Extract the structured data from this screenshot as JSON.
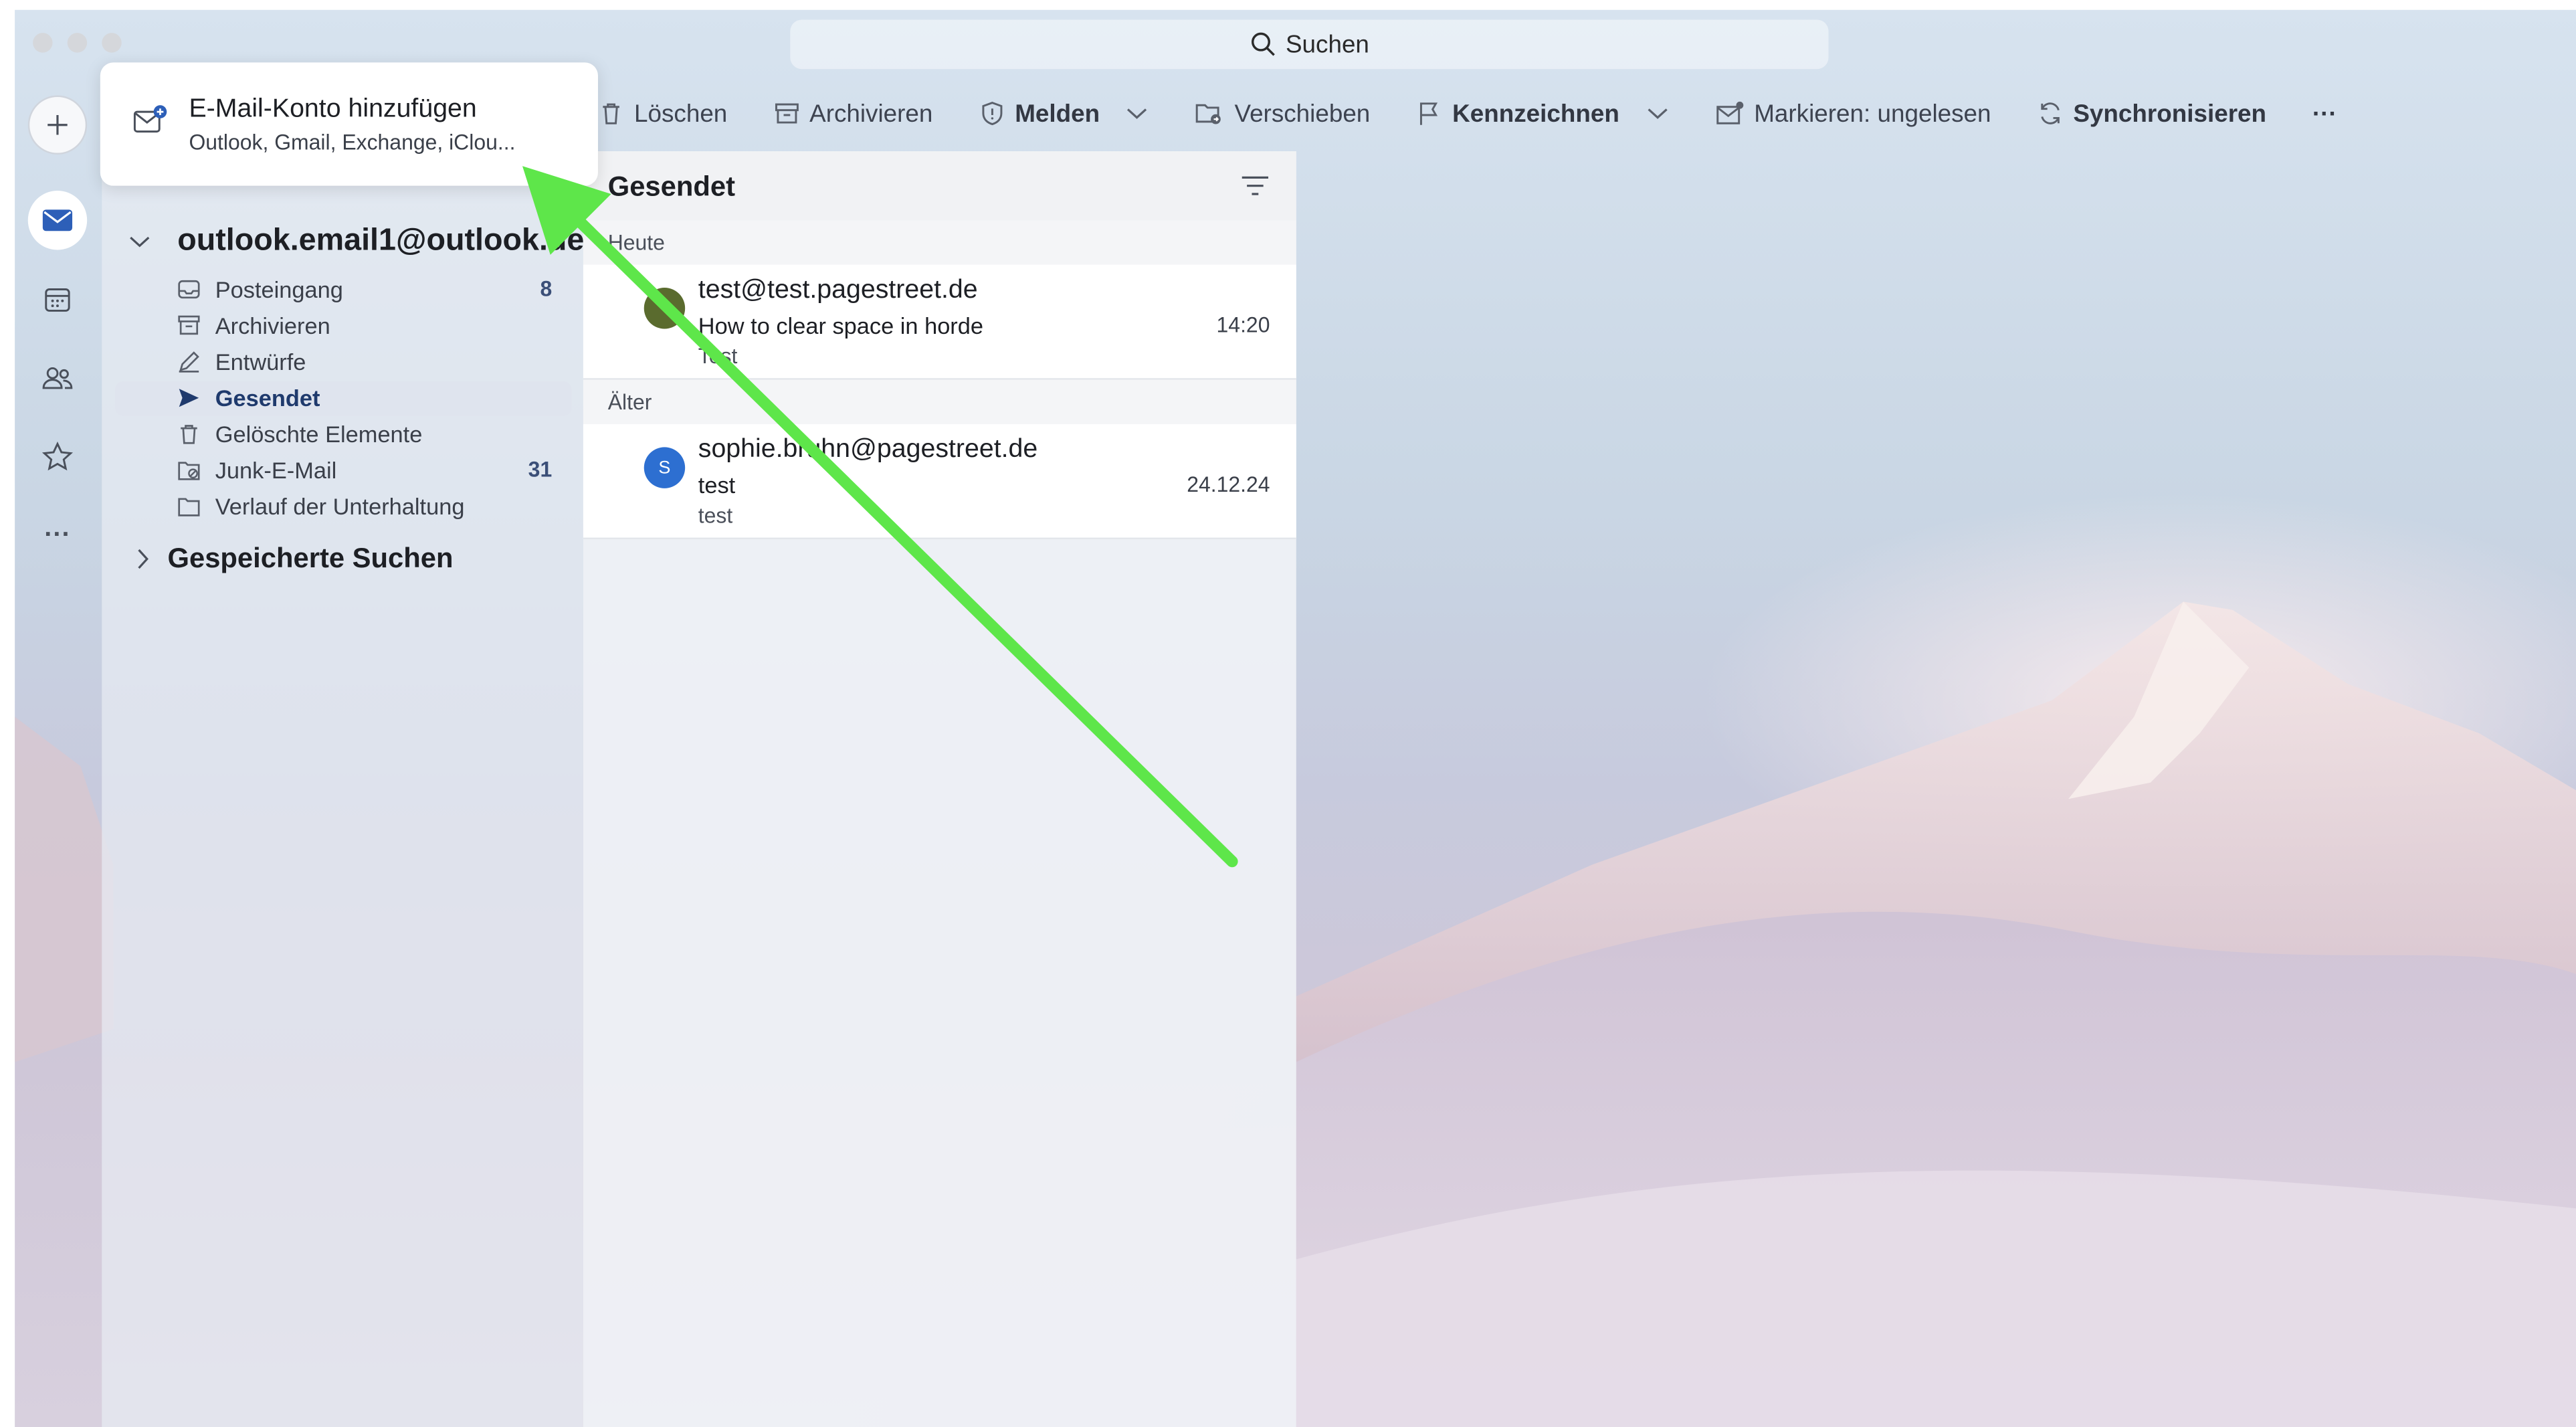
{
  "window": {
    "search_label": "Suchen"
  },
  "toolbar": {
    "delete": "Löschen",
    "archive": "Archivieren",
    "report": "Melden",
    "move": "Verschieben",
    "flag": "Kennzeichnen",
    "mark_unread": "Markieren: ungelesen",
    "sync": "Synchronisieren",
    "more": "···"
  },
  "rail": {
    "more": "···"
  },
  "popup": {
    "title": "E-Mail-Konto hinzufügen",
    "subtitle": "Outlook, Gmail, Exchange, iClou..."
  },
  "folders": {
    "account": "outlook.email1@outlook.de",
    "items": [
      {
        "label": "Posteingang",
        "count": "8"
      },
      {
        "label": "Archivieren",
        "count": ""
      },
      {
        "label": "Entwürfe",
        "count": ""
      },
      {
        "label": "Gesendet",
        "count": ""
      },
      {
        "label": "Gelöschte Elemente",
        "count": ""
      },
      {
        "label": "Junk-E-Mail",
        "count": "31"
      },
      {
        "label": "Verlauf der Unterhaltung",
        "count": ""
      }
    ],
    "saved_searches": "Gespeicherte Suchen"
  },
  "message_list": {
    "title": "Gesendet",
    "groups": [
      {
        "label": "Heute",
        "messages": [
          {
            "from": "test@test.pagestreet.de",
            "subject": "How to clear space in horde",
            "preview": "Test",
            "time": "14:20",
            "avatar_text": "",
            "avatar_color": "#5a6b2e"
          }
        ]
      },
      {
        "label": "Älter",
        "messages": [
          {
            "from": "sophie.bruhn@pagestreet.de",
            "subject": "test",
            "preview": "test",
            "time": "24.12.24",
            "avatar_text": "S",
            "avatar_color": "#2d6fd1"
          }
        ]
      }
    ]
  },
  "colors": {
    "annotation_arrow": "#5ee64a",
    "accent": "#2d5fb8"
  }
}
